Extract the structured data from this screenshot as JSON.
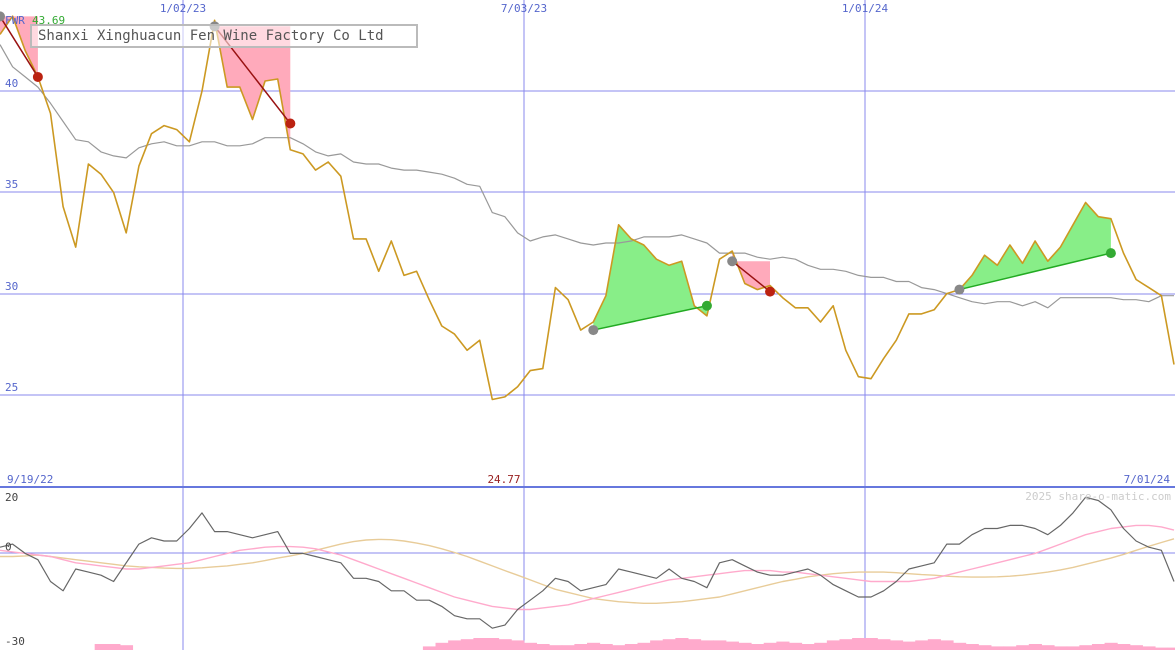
{
  "chart_data": [
    {
      "type": "line",
      "title": "Shanxi Xinghuacun Fen Wine Factory Co Ltd",
      "ticker": "FWR",
      "last_label": "43.69",
      "low_label": "24.77",
      "x_ticks": [
        "1/02/23",
        "7/03/23",
        "1/01/24"
      ],
      "start_date": "9/19/22",
      "end_date": "7/01/24",
      "y_ticks": [
        25,
        30,
        35,
        40
      ],
      "ylim": [
        20.5,
        44.5
      ],
      "grid": true,
      "series": [
        {
          "values": [
            42.8,
            43.7,
            42.0,
            40.7,
            38.9,
            34.3,
            32.3,
            36.4,
            35.9,
            35.0,
            33.0,
            36.3,
            37.9,
            38.3,
            38.1,
            37.5,
            40.0,
            43.5,
            40.2,
            40.2,
            38.6,
            40.5,
            40.6,
            37.1,
            36.9,
            36.1,
            36.5,
            35.8,
            32.7,
            32.7,
            31.1,
            32.6,
            30.9,
            31.1,
            29.7,
            28.4,
            28.0,
            27.2,
            27.7,
            24.77,
            24.9,
            25.4,
            26.2,
            26.3,
            30.3,
            29.7,
            28.2,
            28.6,
            29.9,
            33.4,
            32.7,
            32.4,
            31.7,
            31.4,
            31.6,
            29.4,
            28.9,
            31.7,
            32.1,
            30.5,
            30.2,
            30.4,
            29.8,
            29.3,
            29.3,
            28.6,
            29.4,
            27.2,
            25.9,
            25.8,
            26.8,
            27.7,
            29.0,
            29.0,
            29.2,
            30.0,
            30.2,
            30.9,
            31.9,
            31.4,
            32.4,
            31.5,
            32.6,
            31.6,
            32.3,
            33.4,
            34.5,
            33.8,
            33.7,
            32.0,
            30.7,
            30.3,
            29.9,
            26.5
          ]
        },
        {
          "values": [
            42.3,
            41.2,
            40.7,
            40.2,
            39.4,
            38.5,
            37.6,
            37.5,
            37.0,
            36.8,
            36.7,
            37.2,
            37.4,
            37.5,
            37.3,
            37.3,
            37.5,
            37.5,
            37.3,
            37.3,
            37.4,
            37.7,
            37.7,
            37.7,
            37.4,
            37.0,
            36.8,
            36.9,
            36.5,
            36.4,
            36.4,
            36.2,
            36.1,
            36.1,
            36.0,
            35.9,
            35.7,
            35.4,
            35.3,
            34.0,
            33.8,
            33.0,
            32.6,
            32.8,
            32.9,
            32.7,
            32.5,
            32.4,
            32.5,
            32.5,
            32.6,
            32.8,
            32.8,
            32.8,
            32.9,
            32.7,
            32.5,
            32.0,
            32.0,
            32.0,
            31.8,
            31.7,
            31.8,
            31.7,
            31.4,
            31.2,
            31.2,
            31.1,
            30.9,
            30.8,
            30.8,
            30.6,
            30.6,
            30.3,
            30.2,
            30.0,
            29.8,
            29.6,
            29.5,
            29.6,
            29.6,
            29.4,
            29.6,
            29.3,
            29.8,
            29.8,
            29.8,
            29.8,
            29.8,
            29.7,
            29.7,
            29.6,
            29.9,
            29.9
          ]
        }
      ],
      "signals": [
        {
          "kind": "loss",
          "from_x": 0,
          "from_y": 43.69,
          "to_x": 3,
          "to_y": 40.7
        },
        {
          "kind": "loss",
          "from_x": 17,
          "from_y": 43.2,
          "to_x": 23,
          "to_y": 38.4
        },
        {
          "kind": "gain",
          "from_x": 47,
          "from_y": 28.2,
          "to_x": 56,
          "to_y": 29.4
        },
        {
          "kind": "loss",
          "from_x": 58,
          "from_y": 31.6,
          "to_x": 61,
          "to_y": 30.1
        },
        {
          "kind": "gain",
          "from_x": 76,
          "from_y": 30.2,
          "to_x": 88,
          "to_y": 32.0
        }
      ],
      "colors": {
        "price": "#cc9922",
        "average": "#999999",
        "grid": "#8888ee",
        "gain": "#88ee88",
        "loss": "#ffaabb"
      }
    },
    {
      "type": "line",
      "watermark": "2025 share-o-matic.com",
      "y_ticks": [
        20,
        0,
        -30
      ],
      "ylim": [
        -31,
        21
      ],
      "series": [
        {
          "values": [
            2,
            3,
            0,
            -2,
            -9,
            -12,
            -5,
            -6,
            -7,
            -9,
            -3,
            3,
            5,
            4,
            4,
            8,
            13,
            7,
            7,
            6,
            5,
            6,
            7,
            0,
            0,
            -1,
            -2,
            -3,
            -8,
            -8,
            -9,
            -12,
            -12,
            -15,
            -15,
            -17,
            -20,
            -21,
            -21,
            -24,
            -23,
            -18,
            -15,
            -12,
            -8,
            -9,
            -12,
            -11,
            -10,
            -5,
            -6,
            -7,
            -8,
            -5,
            -8,
            -9,
            -11,
            -3,
            -2,
            -4,
            -6,
            -7,
            -7,
            -6,
            -5,
            -7,
            -10,
            -12,
            -14,
            -14,
            -12,
            -9,
            -5,
            -4,
            -3,
            3,
            3,
            6,
            8,
            8,
            9,
            9,
            8,
            6,
            9,
            13,
            18,
            17,
            14,
            8,
            4,
            2,
            1,
            -9
          ]
        },
        {
          "values": [
            1,
            0.5,
            0,
            -0.5,
            -1,
            -2,
            -3,
            -3.5,
            -4,
            -4.5,
            -5,
            -5,
            -4.5,
            -4,
            -3.5,
            -3,
            -2,
            -1,
            0,
            1,
            1.5,
            2,
            2.2,
            2.2,
            2,
            1.5,
            0.5,
            -0.5,
            -2,
            -3.5,
            -5,
            -6.5,
            -8,
            -9.5,
            -11,
            -12.5,
            -14,
            -15,
            -16,
            -17,
            -17.5,
            -18,
            -18,
            -17.5,
            -17,
            -16.5,
            -15.5,
            -14.5,
            -13.5,
            -12.5,
            -11.5,
            -10.5,
            -9.5,
            -8.5,
            -8,
            -7.5,
            -7,
            -6.5,
            -6,
            -5.5,
            -5.5,
            -5.5,
            -6,
            -6,
            -6.5,
            -7,
            -7.5,
            -8,
            -8.5,
            -9,
            -9,
            -9,
            -9,
            -8.5,
            -8,
            -7,
            -6,
            -5,
            -4,
            -3,
            -2,
            -1,
            0,
            1.5,
            3,
            4.5,
            6,
            7,
            8,
            8.5,
            9,
            9,
            8.5,
            7.5
          ]
        },
        {
          "values": [
            -1,
            -1,
            -0.8,
            -0.5,
            -1,
            -1.5,
            -2,
            -2.5,
            -3,
            -3.5,
            -4,
            -4.3,
            -4.5,
            -4.7,
            -4.8,
            -4.8,
            -4.6,
            -4.3,
            -4,
            -3.5,
            -3,
            -2.3,
            -1.5,
            -0.8,
            0,
            1,
            2,
            3,
            3.8,
            4.3,
            4.5,
            4.4,
            4,
            3.3,
            2.5,
            1.5,
            0.3,
            -1,
            -2.5,
            -4,
            -5.5,
            -7,
            -8.5,
            -10,
            -11.5,
            -12.5,
            -13.5,
            -14.5,
            -15,
            -15.5,
            -15.8,
            -16,
            -16,
            -15.8,
            -15.5,
            -15,
            -14.5,
            -14,
            -13,
            -12,
            -11,
            -10,
            -9,
            -8.3,
            -7.5,
            -7,
            -6.5,
            -6.2,
            -6,
            -6,
            -6,
            -6.2,
            -6.5,
            -6.8,
            -7,
            -7.3,
            -7.5,
            -7.6,
            -7.6,
            -7.5,
            -7.3,
            -7,
            -6.5,
            -6,
            -5.3,
            -4.5,
            -3.5,
            -2.5,
            -1.5,
            -0.3,
            1,
            2.3,
            3.5,
            4.7
          ]
        }
      ],
      "volume": [
        0,
        0,
        0,
        0,
        0,
        0,
        0,
        0,
        0.5,
        0.5,
        0.4,
        0,
        0,
        0,
        0,
        0,
        0,
        0,
        0,
        0,
        0,
        0,
        0,
        0,
        0,
        0,
        0,
        0,
        0,
        0,
        0,
        0,
        0,
        0,
        0.3,
        0.6,
        0.8,
        0.9,
        1,
        1,
        0.9,
        0.8,
        0.6,
        0.5,
        0.4,
        0.4,
        0.5,
        0.6,
        0.5,
        0.4,
        0.5,
        0.6,
        0.8,
        0.9,
        1,
        0.9,
        0.8,
        0.8,
        0.7,
        0.6,
        0.5,
        0.6,
        0.7,
        0.6,
        0.5,
        0.6,
        0.8,
        0.9,
        1,
        1,
        0.9,
        0.8,
        0.7,
        0.8,
        0.9,
        0.8,
        0.6,
        0.5,
        0.4,
        0.3,
        0.3,
        0.4,
        0.5,
        0.4,
        0.3,
        0.3,
        0.4,
        0.5,
        0.6,
        0.5,
        0.4,
        0.3,
        0.2,
        0.2
      ],
      "colors": {
        "momentum": "#666666",
        "fast": "#ffaacc",
        "slow": "#e8cc99",
        "volume": "#ffaacc",
        "zero": "#8888ee"
      }
    }
  ]
}
